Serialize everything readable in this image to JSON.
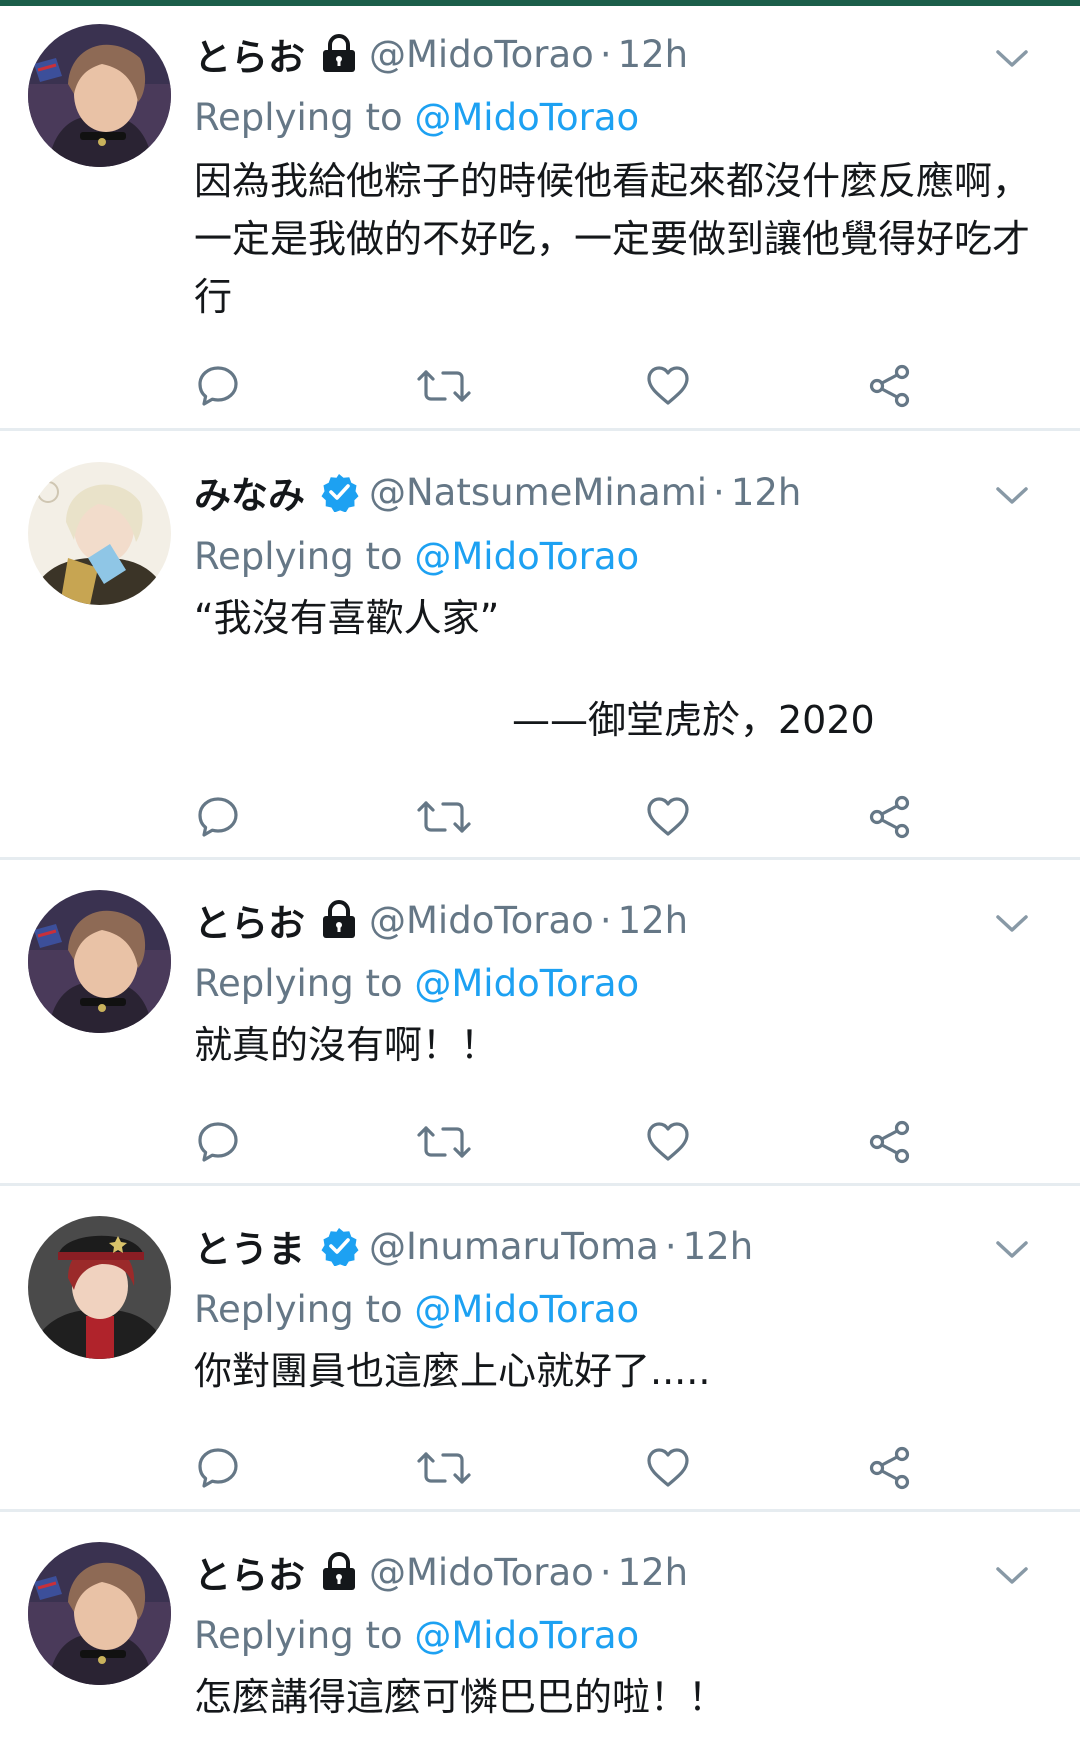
{
  "colors": {
    "accent": "#1da1f2",
    "muted": "#657786",
    "text": "#14171a",
    "divider": "#e6ecf0",
    "top_bar": "#1b5e4a"
  },
  "reply_prefix": "Replying to",
  "tweets": [
    {
      "display_name": "とらお",
      "badge": "lock-icon",
      "handle": "@MidoTorao",
      "dot": "·",
      "time": "12h",
      "replying_to": "@MidoTorao",
      "text": "因為我給他粽子的時候他看起來都沒什麼反應啊，\n一定是我做的不好吃，一定要做到讓他覺得好吃才\n行"
    },
    {
      "display_name": "みなみ",
      "badge": "verified-icon",
      "handle": "@NatsumeMinami",
      "dot": "·",
      "time": "12h",
      "replying_to": "@MidoTorao",
      "text": "“我沒有喜歡人家”",
      "signature": "——御堂虎於，2020"
    },
    {
      "display_name": "とらお",
      "badge": "lock-icon",
      "handle": "@MidoTorao",
      "dot": "·",
      "time": "12h",
      "replying_to": "@MidoTorao",
      "text": "就真的沒有啊！！"
    },
    {
      "display_name": "とうま",
      "badge": "verified-icon",
      "handle": "@InumaruToma",
      "dot": "·",
      "time": "12h",
      "replying_to": "@MidoTorao",
      "text": "你對團員也這麼上心就好了....."
    },
    {
      "display_name": "とらお",
      "badge": "lock-icon",
      "handle": "@MidoTorao",
      "dot": "·",
      "time": "12h",
      "replying_to": "@MidoTorao",
      "text": "怎麼講得這麼可憐巴巴的啦！！"
    }
  ]
}
